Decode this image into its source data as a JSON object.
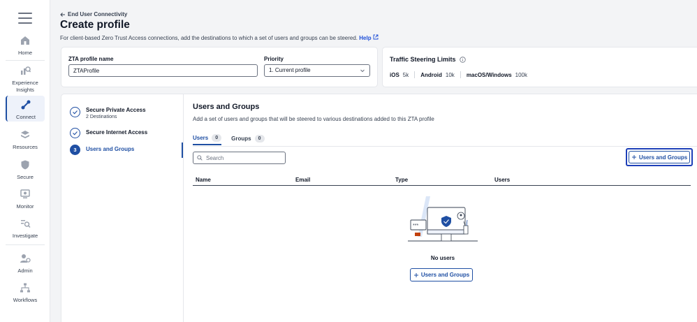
{
  "nav": {
    "items": [
      {
        "label": "Home",
        "icon": "home-icon"
      },
      {
        "label": "Experience Insights",
        "icon": "insights-icon"
      },
      {
        "label": "Connect",
        "icon": "connect-icon",
        "active": true
      },
      {
        "label": "Resources",
        "icon": "resources-icon"
      },
      {
        "label": "Secure",
        "icon": "shield-icon"
      },
      {
        "label": "Monitor",
        "icon": "monitor-icon"
      },
      {
        "label": "Investigate",
        "icon": "investigate-icon"
      },
      {
        "label": "Admin",
        "icon": "admin-icon"
      },
      {
        "label": "Workflows",
        "icon": "workflows-icon"
      }
    ]
  },
  "header": {
    "breadcrumb": "End User Connectivity",
    "title": "Create profile",
    "subtitle": "For client-based Zero Trust Access connections, add the destinations to which a set of users and groups can be steered.",
    "help_label": "Help"
  },
  "profile": {
    "name_label": "ZTA profile name",
    "name_value": "ZTAProfile",
    "priority_label": "Priority",
    "priority_value": "1. Current profile"
  },
  "traffic": {
    "title": "Traffic Steering Limits",
    "limits": [
      {
        "os": "iOS",
        "value": "5k"
      },
      {
        "os": "Android",
        "value": "10k"
      },
      {
        "os": "macOS/Windows",
        "value": "100k"
      }
    ]
  },
  "steps": [
    {
      "title": "Secure Private Access",
      "sub": "2 Destinations",
      "state": "done"
    },
    {
      "title": "Secure Internet Access",
      "sub": "",
      "state": "done"
    },
    {
      "title": "Users and Groups",
      "sub": "",
      "state": "current",
      "number": "3"
    }
  ],
  "main": {
    "title": "Users and Groups",
    "subtitle": "Add a set of users and groups that will be steered to various destinations added to this ZTA profile",
    "tabs": [
      {
        "label": "Users",
        "count": "0"
      },
      {
        "label": "Groups",
        "count": "0"
      }
    ],
    "search_placeholder": "Search",
    "add_button": "Users and Groups",
    "columns": [
      "Name",
      "Email",
      "Type",
      "Users"
    ],
    "empty_text": "No users",
    "empty_button": "Users and Groups"
  },
  "colors": {
    "accent": "#1f4fa3",
    "focus_outline": "#1d3fb8"
  }
}
